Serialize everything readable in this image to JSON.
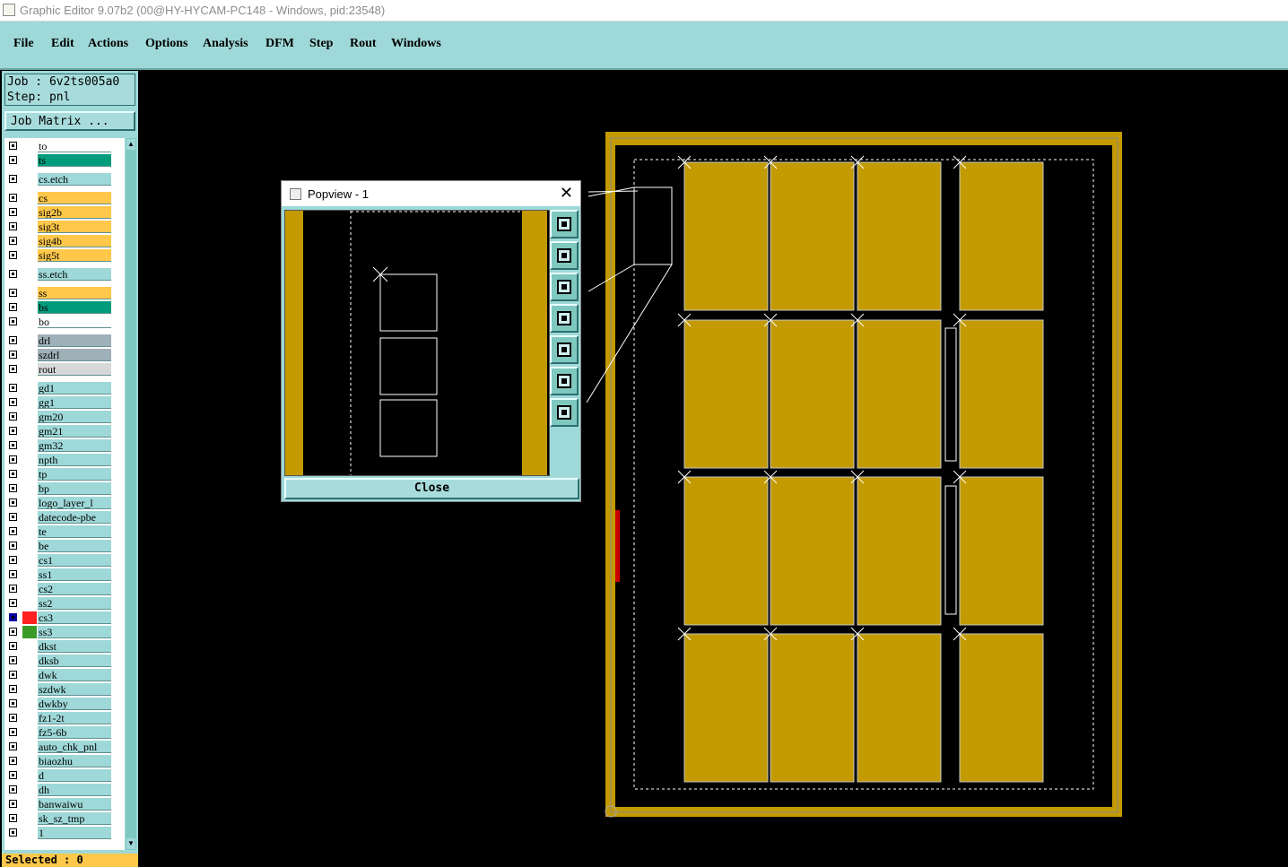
{
  "window": {
    "title": "Graphic Editor 9.07b2 (00@HY-HYCAM-PC148 - Windows, pid:23548)"
  },
  "menu": [
    "File",
    "Edit",
    "Actions",
    "Options",
    "Analysis",
    "DFM",
    "Step",
    "Rout",
    "Windows"
  ],
  "job": {
    "job_line": "Job : 6v2ts005a0",
    "step_line": "Step: pnl"
  },
  "job_matrix_label": "Job Matrix ...",
  "layers": [
    {
      "name": "to",
      "color": "#ffffff"
    },
    {
      "name": "ts",
      "color": "#009c7c"
    },
    {
      "name": "cs.etch",
      "color": "#9fd8d8"
    },
    {
      "name": "cs",
      "color": "#ffc84a"
    },
    {
      "name": "sig2b",
      "color": "#ffc84a"
    },
    {
      "name": "sig3t",
      "color": "#ffc84a"
    },
    {
      "name": "sig4b",
      "color": "#ffc84a"
    },
    {
      "name": "sig5t",
      "color": "#ffc84a"
    },
    {
      "name": "ss.etch",
      "color": "#9fd8d8"
    },
    {
      "name": "ss",
      "color": "#ffc84a"
    },
    {
      "name": "bs",
      "color": "#009c7c"
    },
    {
      "name": "bo",
      "color": "#ffffff"
    },
    {
      "name": "drl",
      "color": "#a0b0b8"
    },
    {
      "name": "szdrl",
      "color": "#a0b0b8"
    },
    {
      "name": "rout",
      "color": "#d8d8d8"
    },
    {
      "name": "gd1",
      "color": "#9fd8d8"
    },
    {
      "name": "gg1",
      "color": "#9fd8d8"
    },
    {
      "name": "gm20",
      "color": "#9fd8d8"
    },
    {
      "name": "gm21",
      "color": "#9fd8d8"
    },
    {
      "name": "gm32",
      "color": "#9fd8d8"
    },
    {
      "name": "npth",
      "color": "#9fd8d8"
    },
    {
      "name": "tp",
      "color": "#9fd8d8"
    },
    {
      "name": "bp",
      "color": "#9fd8d8"
    },
    {
      "name": "logo_layer_l",
      "color": "#9fd8d8"
    },
    {
      "name": "datecode-pbe",
      "color": "#9fd8d8"
    },
    {
      "name": "te",
      "color": "#9fd8d8"
    },
    {
      "name": "be",
      "color": "#9fd8d8"
    },
    {
      "name": "cs1",
      "color": "#9fd8d8"
    },
    {
      "name": "ss1",
      "color": "#9fd8d8"
    },
    {
      "name": "cs2",
      "color": "#9fd8d8"
    },
    {
      "name": "ss2",
      "color": "#9fd8d8"
    },
    {
      "name": "cs3",
      "color": "#9fd8d8",
      "swatch": "#ff2020",
      "active": true
    },
    {
      "name": "ss3",
      "color": "#9fd8d8",
      "swatch": "#3a9a28"
    },
    {
      "name": "dkst",
      "color": "#9fd8d8"
    },
    {
      "name": "dksb",
      "color": "#9fd8d8"
    },
    {
      "name": "dwk",
      "color": "#9fd8d8"
    },
    {
      "name": "szdwk",
      "color": "#9fd8d8"
    },
    {
      "name": "dwkby",
      "color": "#9fd8d8"
    },
    {
      "name": "fz1-2t",
      "color": "#9fd8d8"
    },
    {
      "name": "fz5-6b",
      "color": "#9fd8d8"
    },
    {
      "name": "auto_chk_pnl",
      "color": "#9fd8d8"
    },
    {
      "name": "biaozhu",
      "color": "#9fd8d8"
    },
    {
      "name": "d",
      "color": "#9fd8d8"
    },
    {
      "name": "dh",
      "color": "#9fd8d8"
    },
    {
      "name": "banwaiwu",
      "color": "#9fd8d8"
    },
    {
      "name": "sk_sz_tmp",
      "color": "#9fd8d8"
    },
    {
      "name": "1",
      "color": "#9fd8d8"
    }
  ],
  "selected_label": "Selected : 0",
  "popview": {
    "title": "Popview - 1",
    "close_label": "Close"
  },
  "toolbar_icons": [
    "zoom-home-icon",
    "pan-up-icon",
    "pan-down-icon",
    "pan-left-icon",
    "pan-right-icon",
    "zoom-in-icon",
    "zoom-out-icon"
  ],
  "colors": {
    "board": "#c39a00",
    "panel_bg": "#9fd8d8",
    "highlight": "#ffc84a",
    "teal": "#009c7c"
  }
}
